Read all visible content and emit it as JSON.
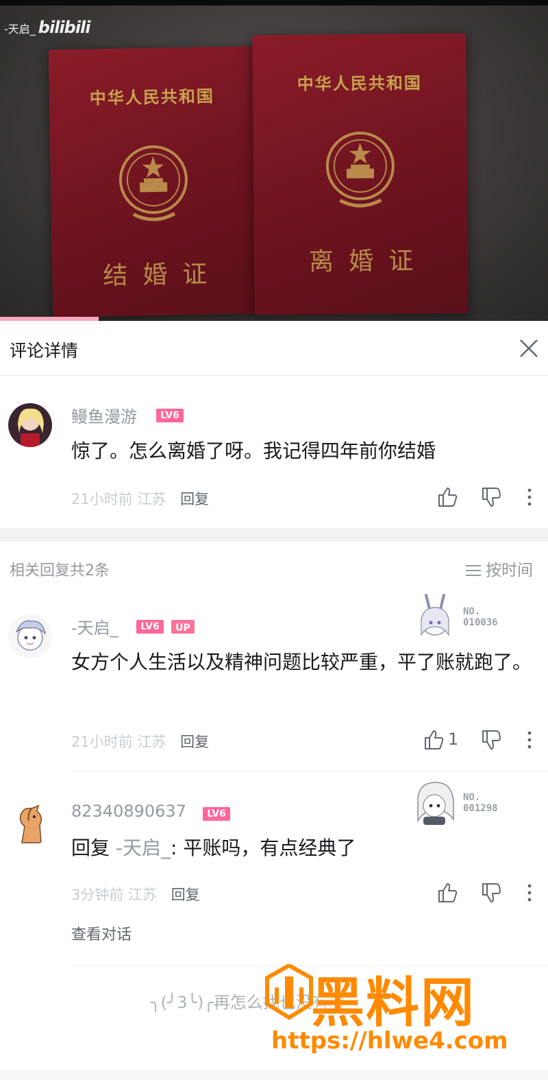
{
  "video": {
    "watermark_user": "-天启_",
    "watermark_brand": "bilibili",
    "booklet_left": {
      "country": "中华人民共和国",
      "name": "结婚证"
    },
    "booklet_right": {
      "country": "中华人民共和国",
      "name": "离婚证"
    },
    "progress_fraction": 0.18
  },
  "header": {
    "title": "评论详情",
    "close_icon": "close-icon"
  },
  "main_comment": {
    "username": "鳗鱼漫游",
    "level": "LV6",
    "text": "惊了。怎么离婚了呀。我记得四年前你结婚",
    "time": "21小时前",
    "location": "江苏",
    "reply_label": "回复"
  },
  "related": {
    "count_label": "相关回复共2条",
    "sort_label": "按时间"
  },
  "replies": [
    {
      "username": "-天启_",
      "level": "LV6",
      "badge": "UP",
      "medal_no_label": "NO.",
      "medal_no_value": "010036",
      "text": "女方个人生活以及精神问题比较严重，平了账就跑了。",
      "time": "21小时前",
      "location": "江苏",
      "reply_label": "回复",
      "likes": "1"
    },
    {
      "username": "82340890637",
      "level": "LV6",
      "medal_no_label": "NO.",
      "medal_no_value": "001298",
      "reply_prefix": "回复 ",
      "reply_to": "-天启_",
      "text_after": ": 平账吗，有点经典了",
      "time": "3分钟前",
      "location": "江苏",
      "reply_label": "回复",
      "view_conversation": "查看对话"
    }
  ],
  "footer": {
    "end_text": "╮(╯3╰)╭再怎么找也没有啦",
    "site_brand": "黑料网",
    "site_url": "https://hlwe4.com"
  },
  "colors": {
    "accent": "#fb7299",
    "level_badge": "#ff6699",
    "watermark_orange": "#ff8a00",
    "text_gray": "#9499a0"
  }
}
